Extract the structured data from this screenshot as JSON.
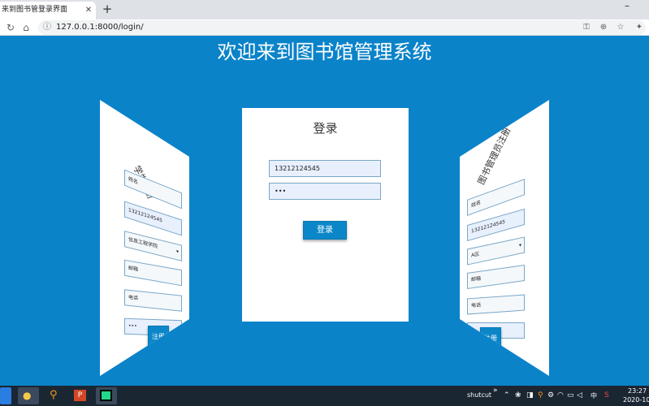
{
  "browser": {
    "tab_title": "来到图书管登录界面",
    "url": "127.0.0.1:8000/login/"
  },
  "page": {
    "title": "欢迎来到图书馆管理系统"
  },
  "login": {
    "heading": "登录",
    "username": "13212124545",
    "password": "•••",
    "button": "登录"
  },
  "student_register": {
    "heading": "学生注册",
    "name_placeholder": "姓名",
    "phone": "13212124545",
    "major": "信息工程学院",
    "email_placeholder": "邮箱",
    "tel_placeholder": "电话",
    "password": "•••",
    "button": "注册"
  },
  "admin_register": {
    "heading": "图书管理员注册",
    "name": "姓名",
    "phone": "13212124545",
    "college": "A区",
    "email": "邮箱",
    "tel": "电话",
    "password": "•",
    "button": "注册"
  },
  "taskbar": {
    "shortcut_label": "shutcut",
    "ime": "中",
    "time": "23:27",
    "date": "2020-10"
  },
  "icons": {
    "back": "back-arrow-icon",
    "reload": "reload-icon",
    "home": "home-icon",
    "info": "info-icon",
    "key": "key-icon",
    "zoom": "zoom-icon",
    "star": "star-icon",
    "extension": "puzzle-icon"
  },
  "colors": {
    "page_background": "#0a83c9",
    "button": "#0b87c9",
    "field": "#e8f0fe"
  }
}
